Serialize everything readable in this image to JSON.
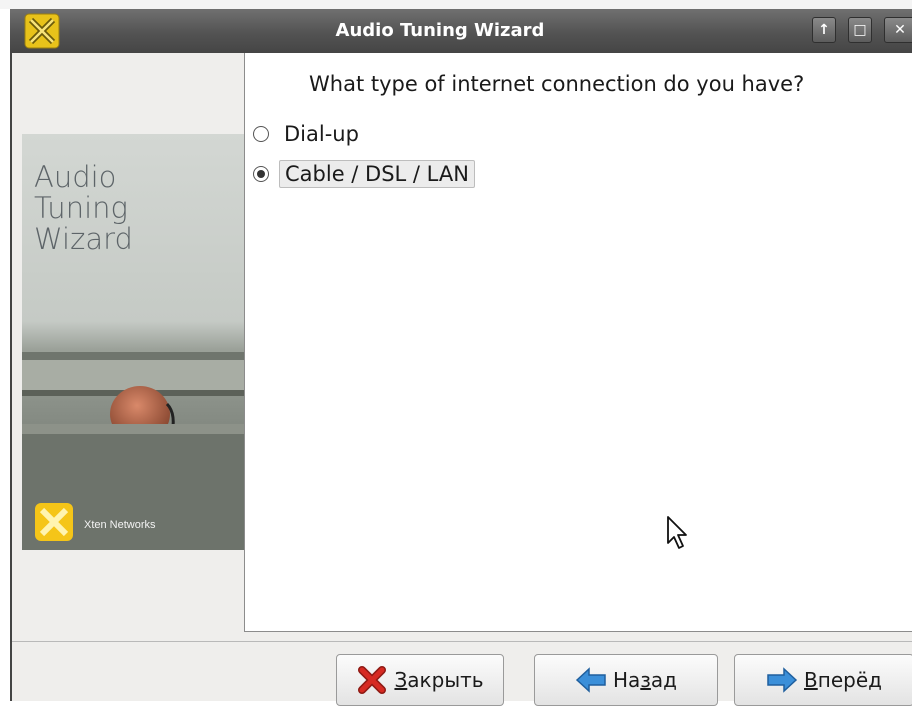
{
  "window": {
    "title": "Audio Tuning Wizard",
    "controls": {
      "restore": "↑",
      "maximize": "□",
      "close": "✕"
    }
  },
  "side_panel": {
    "title_lines": [
      "Audio",
      "Tuning",
      "Wizard"
    ],
    "brand": "Xten Networks"
  },
  "page": {
    "question": "What type of internet connection do you have?",
    "options": [
      {
        "label": "Dial-up",
        "selected": false
      },
      {
        "label": "Cable / DSL / LAN",
        "selected": true
      }
    ]
  },
  "buttons": {
    "close": {
      "pre": "",
      "mnemonic": "З",
      "post": "акрыть"
    },
    "back": {
      "pre": "На",
      "mnemonic": "з",
      "post": "ад"
    },
    "next": {
      "pre": "",
      "mnemonic": "В",
      "post": "перёд"
    }
  },
  "colors": {
    "brand_yellow": "#f5c518",
    "close_red": "#d62a22",
    "arrow_blue": "#3b8fd9"
  },
  "icons": [
    "app-x-icon",
    "close-x-icon",
    "back-arrow-icon",
    "next-arrow-icon",
    "mouse-cursor-icon"
  ]
}
